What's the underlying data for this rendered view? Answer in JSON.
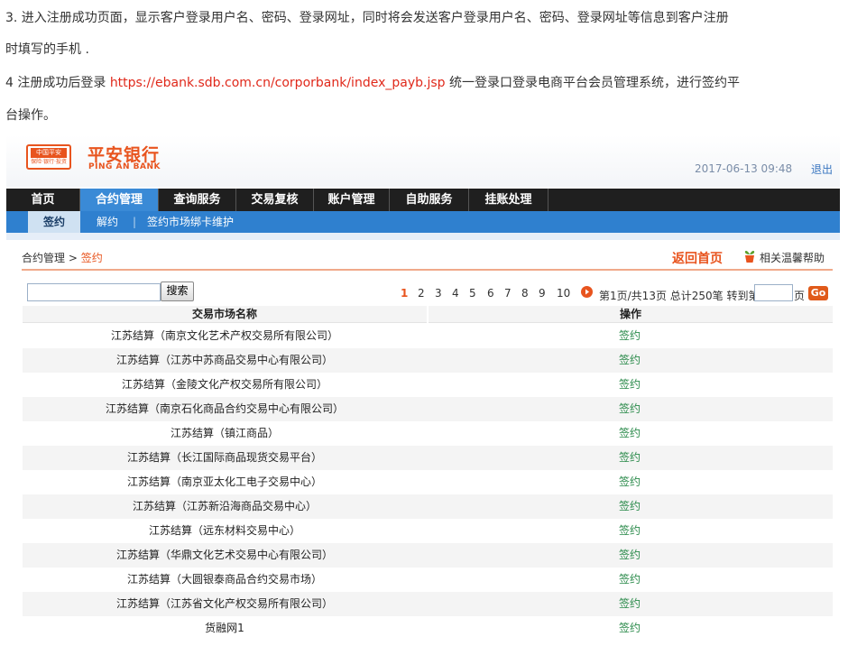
{
  "doc": {
    "step3_line1": "3. 进入注册成功页面，显示客户登录用户名、密码、登录网址，同时将会发送客户登录用户名、密码、登录网址等信息到客户注册",
    "step3_line2": "时填写的手机 .",
    "step4_prefix": "4 注册成功后登录 ",
    "step4_link": "https://ebank.sdb.com.cn/corporbank/index_payb.jsp",
    "step4_suffix": " 统一登录口登录电商平台会员管理系统，进行签约平",
    "step4_line2": "台操作。"
  },
  "header": {
    "badge_top": "中国平安",
    "badge_bottom": "保险·银行·投资",
    "logo_cn": "平安银行",
    "logo_en": "PING AN BANK",
    "datetime": "2017-06-13  09:48",
    "logout": "退出"
  },
  "nav": {
    "items": [
      "首页",
      "合约管理",
      "查询服务",
      "交易复核",
      "账户管理",
      "自助服务",
      "挂账处理"
    ],
    "active": "合约管理",
    "sub": [
      "签约",
      "解约",
      "签约市场绑卡维护"
    ],
    "sub_active": "签约"
  },
  "breadcrumb": {
    "parent": "合约管理",
    "sep": " > ",
    "current": "签约"
  },
  "actions": {
    "back_home": "返回首页",
    "help": "相关温馨帮助"
  },
  "search": {
    "button": "搜索",
    "value": ""
  },
  "pager": {
    "pages": [
      "1",
      "2",
      "3",
      "4",
      "5",
      "6",
      "7",
      "8",
      "9",
      "10"
    ],
    "current_page": "1",
    "summary": "第1页/共13页  总计250笔  转到第",
    "page_unit": "页",
    "go": "Go"
  },
  "table": {
    "headers": [
      "交易市场名称",
      "操作"
    ],
    "rows": [
      {
        "name": "江苏结算（南京文化艺术产权交易所有限公司）",
        "action": "签约"
      },
      {
        "name": "江苏结算（江苏中苏商品交易中心有限公司）",
        "action": "签约"
      },
      {
        "name": "江苏结算（金陵文化产权交易所有限公司）",
        "action": "签约"
      },
      {
        "name": "江苏结算（南京石化商品合约交易中心有限公司）",
        "action": "签约"
      },
      {
        "name": "江苏结算（镇江商品）",
        "action": "签约"
      },
      {
        "name": "江苏结算（长江国际商品现货交易平台）",
        "action": "签约"
      },
      {
        "name": "江苏结算（南京亚太化工电子交易中心）",
        "action": "签约"
      },
      {
        "name": "江苏结算（江苏新沿海商品交易中心）",
        "action": "签约"
      },
      {
        "name": "江苏结算（远东材料交易中心）",
        "action": "签约"
      },
      {
        "name": "江苏结算（华鼎文化艺术交易中心有限公司）",
        "action": "签约"
      },
      {
        "name": "江苏结算（大圆银泰商品合约交易市场）",
        "action": "签约"
      },
      {
        "name": "江苏结算（江苏省文化产权交易所有限公司）",
        "action": "签约"
      },
      {
        "name": "货融网1",
        "action": "签约"
      }
    ]
  }
}
